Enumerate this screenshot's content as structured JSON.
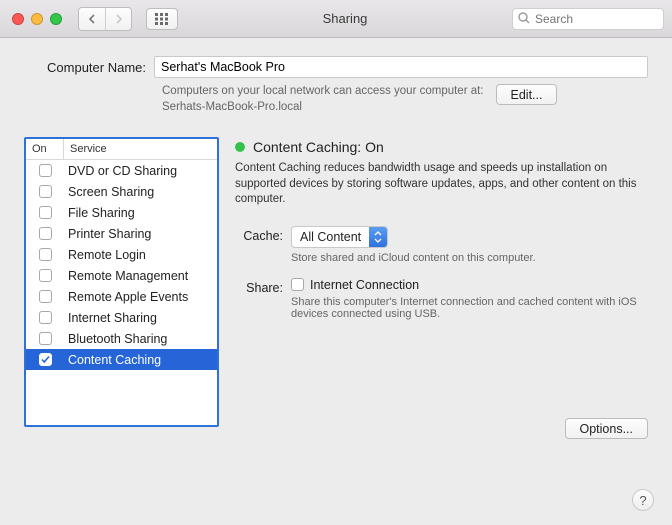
{
  "window": {
    "title": "Sharing"
  },
  "search": {
    "placeholder": "Search"
  },
  "computerName": {
    "label": "Computer Name:",
    "value": "Serhat's MacBook Pro",
    "help1": "Computers on your local network can access your computer at:",
    "help2": "Serhats-MacBook-Pro.local",
    "editLabel": "Edit..."
  },
  "listHeaders": {
    "on": "On",
    "service": "Service"
  },
  "services": [
    {
      "label": "DVD or CD Sharing",
      "on": false,
      "selected": false
    },
    {
      "label": "Screen Sharing",
      "on": false,
      "selected": false
    },
    {
      "label": "File Sharing",
      "on": false,
      "selected": false
    },
    {
      "label": "Printer Sharing",
      "on": false,
      "selected": false
    },
    {
      "label": "Remote Login",
      "on": false,
      "selected": false
    },
    {
      "label": "Remote Management",
      "on": false,
      "selected": false
    },
    {
      "label": "Remote Apple Events",
      "on": false,
      "selected": false
    },
    {
      "label": "Internet Sharing",
      "on": false,
      "selected": false
    },
    {
      "label": "Bluetooth Sharing",
      "on": false,
      "selected": false
    },
    {
      "label": "Content Caching",
      "on": true,
      "selected": true
    }
  ],
  "detail": {
    "statusTitle": "Content Caching: On",
    "description": "Content Caching reduces bandwidth usage and speeds up installation on supported devices by storing software updates, apps, and other content on this computer.",
    "cacheLabel": "Cache:",
    "cacheValue": "All Content",
    "cacheHelp": "Store shared and iCloud content on this computer.",
    "shareLabel": "Share:",
    "shareOption": "Internet Connection",
    "shareHelp": "Share this computer's Internet connection and cached content with iOS devices connected using USB.",
    "optionsLabel": "Options..."
  }
}
